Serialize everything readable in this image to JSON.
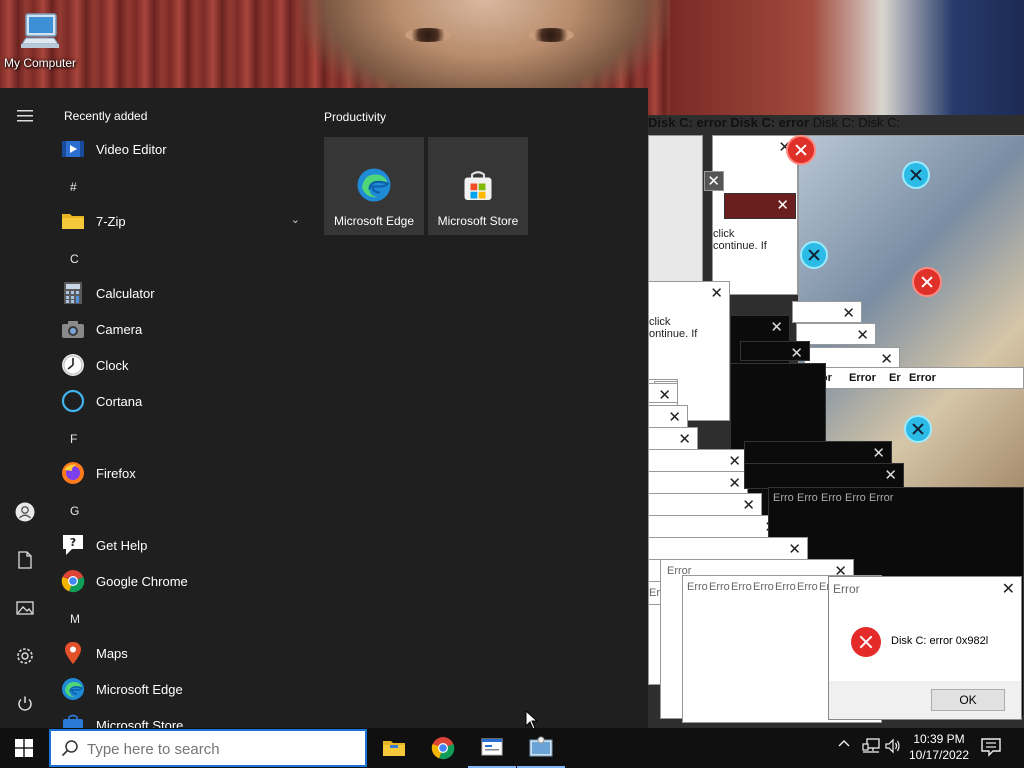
{
  "desktop": {
    "icon_label": "My Computer"
  },
  "start_menu": {
    "recently_added_title": "Recently added",
    "recent_app": "Video Editor",
    "sections": [
      {
        "letter": "#"
      },
      {
        "letter": "C"
      },
      {
        "letter": "F"
      },
      {
        "letter": "G"
      },
      {
        "letter": "M"
      }
    ],
    "apps": [
      {
        "label": "7-Zip",
        "icon": "folder-icon",
        "expandable": true
      },
      {
        "label": "Calculator",
        "icon": "calculator-icon"
      },
      {
        "label": "Camera",
        "icon": "camera-icon"
      },
      {
        "label": "Clock",
        "icon": "clock-icon"
      },
      {
        "label": "Cortana",
        "icon": "cortana-icon"
      },
      {
        "label": "Firefox",
        "icon": "firefox-icon"
      },
      {
        "label": "Get Help",
        "icon": "get-help-icon"
      },
      {
        "label": "Google Chrome",
        "icon": "chrome-icon"
      },
      {
        "label": "Maps",
        "icon": "maps-icon"
      },
      {
        "label": "Microsoft Edge",
        "icon": "edge-icon"
      },
      {
        "label": "Microsoft Store",
        "icon": "store-icon"
      }
    ],
    "tiles_title": "Productivity",
    "tiles": [
      {
        "label": "Microsoft Edge",
        "icon": "edge-icon"
      },
      {
        "label": "Microsoft Store",
        "icon": "store-icon"
      }
    ],
    "rail": [
      "hamburger-icon",
      "user-icon",
      "documents-icon",
      "pictures-icon",
      "settings-icon",
      "power-icon"
    ]
  },
  "errors": {
    "window_title": "Error",
    "message_fragment_1": "click",
    "message_fragment_2": "ontinue. If",
    "message_fragment_3": "continue. If",
    "disk_short": "Disk C: error",
    "disk_c": "Disk C:",
    "disk_err": "Disk C: error",
    "cascade_titles": [
      "Erro",
      "Erro",
      "Erro",
      "Erro",
      "Erro",
      "Erro",
      "Er"
    ],
    "dark_titles": [
      "Error",
      "Erro",
      "Error",
      "Er",
      "Error"
    ],
    "dialog": {
      "title": "Error",
      "message": "Disk C: error 0x982l",
      "ok_label": "OK"
    }
  },
  "taskbar": {
    "search_placeholder": "Type here to search",
    "apps": [
      "file-explorer-icon",
      "chrome-icon",
      "app-window-icon",
      "error-app-icon"
    ],
    "time": "10:39 PM",
    "date": "10/17/2022"
  },
  "colors": {
    "start_bg": "#1f1f1f",
    "tile_bg": "#363636",
    "taskbar_bg": "#101010",
    "accent": "#1a73d8",
    "error_red": "#e52a2a"
  }
}
